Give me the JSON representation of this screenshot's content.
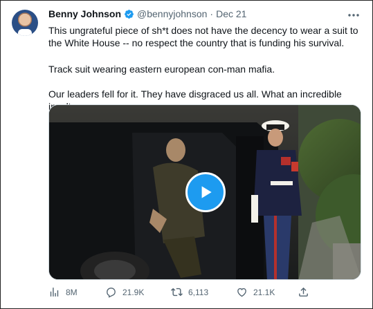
{
  "author": {
    "name": "Benny Johnson",
    "handle": "@bennyjohnson",
    "separator": "·",
    "date": "Dec 21"
  },
  "tweet": {
    "paragraph1": "This ungrateful piece of sh*t does not have the decency to wear a suit to the White House -- no respect the country that is funding his survival.",
    "paragraph2": "Track suit wearing eastern european con-man mafia.",
    "paragraph3": "Our leaders fell for it. They have disgraced us all. What an incredible insult."
  },
  "actions": {
    "views": "8M",
    "replies": "21.9K",
    "retweets": "6,113",
    "likes": "21.1K"
  },
  "colors": {
    "accent": "#1d9bf0",
    "muted": "#536471",
    "text": "#0f1419"
  },
  "icons": [
    "verified-badge-icon",
    "more-icon",
    "play-icon",
    "views-icon",
    "reply-icon",
    "retweet-icon",
    "like-icon",
    "share-icon"
  ]
}
